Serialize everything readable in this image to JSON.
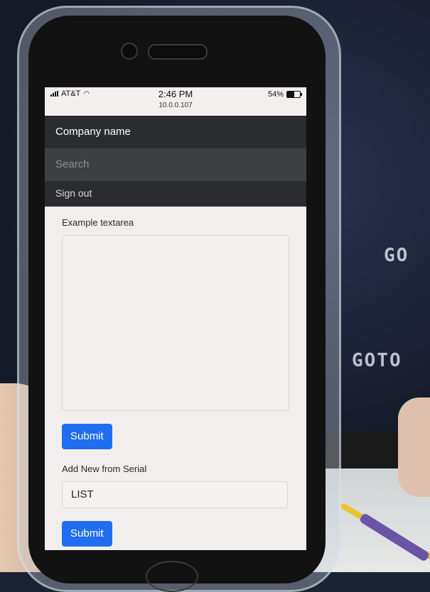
{
  "status_bar": {
    "carrier": "AT&T",
    "time": "2:46 PM",
    "url": "10.0.0.107",
    "battery_percent": "54%",
    "battery_level": 0.54
  },
  "navbar": {
    "brand": "Company name"
  },
  "search": {
    "placeholder": "Search"
  },
  "nav": {
    "sign_out": "Sign out"
  },
  "form": {
    "textarea_label": "Example textarea",
    "textarea_value": "",
    "submit_1": "Submit",
    "serial_label": "Add New from Serial",
    "serial_value": "LIST",
    "submit_2": "Submit"
  },
  "background": {
    "screen_text_1": "GOTO",
    "screen_text_2": "GO"
  },
  "colors": {
    "navbar": "#2b2c2f",
    "search_bg": "#3f4044",
    "primary_button": "#1f6ef0",
    "page_bg": "#f2eeee"
  },
  "icons": [
    "signal-icon",
    "wifi-icon",
    "battery-icon"
  ]
}
